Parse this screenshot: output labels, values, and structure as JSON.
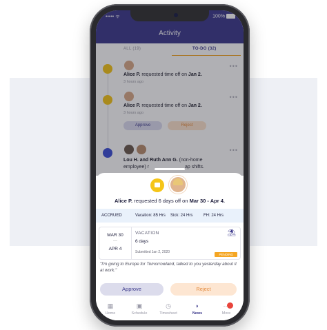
{
  "status": {
    "carrier": "••••• ᯤ",
    "battery": "100%"
  },
  "header": {
    "title": "Activity"
  },
  "tabs": {
    "all": "ALL (19)",
    "todo": "TO-DO (32)"
  },
  "feed": [
    {
      "text_name": "Alice P.",
      "text_rest": " requested time off on ",
      "text_date": "Jan 2.",
      "time": "3 hours ago"
    },
    {
      "text_name": "Alice P.",
      "text_rest": " requested time off on ",
      "text_date": "Jan 2.",
      "time": "3 hours ago",
      "approve": "Approve",
      "reject": "Reject"
    },
    {
      "line1": "Lou H. and Ruth Ann G.",
      "line1_rest": " (non-home",
      "line2": "employee) r",
      "line2_end": "ap shifts."
    }
  ],
  "sheet": {
    "title_name": "Alice P.",
    "title_mid": " requested 6 days off on ",
    "title_dates": "Mar 30 - Apr 4.",
    "accrued": {
      "label": "ACCRUED",
      "vacation": "Vacation: 85 Hrs",
      "sick": "Sick: 24 Hrs",
      "fh": "FH: 24 Hrs"
    },
    "card": {
      "date_start": "MAR 30",
      "dash": "—",
      "date_end": "APR 4",
      "type": "VACATION",
      "days": "6 days",
      "submitted": "Submitted Jan 2, 2020",
      "status": "PENDING",
      "palm_icon": "palm-tree-icon"
    },
    "quote": "\"I'm going to Europe for Tomorrowland, talked to you yesterday about it at work.\"",
    "approve": "Approve",
    "reject": "Reject"
  },
  "nav": [
    {
      "label": "Home",
      "icon": "grid-icon",
      "glyph": "▦"
    },
    {
      "label": "Schedule",
      "icon": "calendar-icon",
      "glyph": "▣"
    },
    {
      "label": "Timesheet",
      "icon": "clock-icon",
      "glyph": "◷"
    },
    {
      "label": "News",
      "icon": "rss-icon",
      "glyph": "◗"
    },
    {
      "label": "More",
      "icon": "more-icon",
      "glyph": "⋯"
    }
  ],
  "colors": {
    "brand": "#3d3a8c",
    "accent": "#f5a623",
    "reject": "#e2893c",
    "approve_bg": "#dcdcec"
  }
}
